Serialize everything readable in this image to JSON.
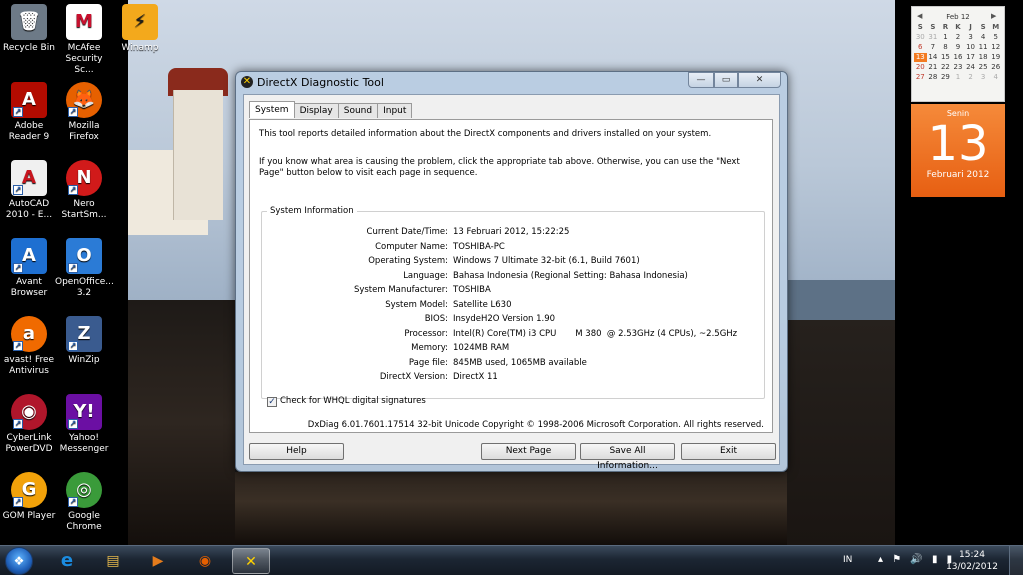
{
  "desktop": {
    "icons": [
      {
        "label": "Recycle Bin",
        "glyph": "🗑",
        "color": "#6d7a87"
      },
      {
        "label": "McAfee Security Sc...",
        "glyph": "M",
        "color": "#c8102e"
      },
      {
        "label": "Winamp",
        "glyph": "⚡",
        "color": "#1f1f1f"
      },
      {
        "label": "Adobe Reader 9",
        "glyph": "A",
        "color": "#b30b00"
      },
      {
        "label": "Mozilla Firefox",
        "glyph": "🦊",
        "color": "#e66000"
      },
      {
        "label": "AutoCAD 2010 - E...",
        "glyph": "A",
        "color": "#c9151e"
      },
      {
        "label": "Nero StartSm...",
        "glyph": "N",
        "color": "#d11a1a"
      },
      {
        "label": "Avant Browser",
        "glyph": "A",
        "color": "#1e6fd1"
      },
      {
        "label": "OpenOffice... 3.2",
        "glyph": "O",
        "color": "#2b7bd6"
      },
      {
        "label": "avast! Free Antivirus",
        "glyph": "a",
        "color": "#f06a00"
      },
      {
        "label": "WinZip",
        "glyph": "Z",
        "color": "#3a5b8f"
      },
      {
        "label": "CyberLink PowerDVD",
        "glyph": "◉",
        "color": "#b0162b"
      },
      {
        "label": "Yahoo! Messenger",
        "glyph": "Y!",
        "color": "#6b0fa3"
      },
      {
        "label": "GOM Player",
        "glyph": "G",
        "color": "#f2a20a"
      },
      {
        "label": "Google Chrome",
        "glyph": "◎",
        "color": "#3a9b3a"
      }
    ]
  },
  "calendar": {
    "month_label": "Feb 12",
    "days_of_week": [
      "S",
      "S",
      "R",
      "K",
      "J",
      "S",
      "M"
    ],
    "weeks": [
      [
        "30",
        "31",
        "1",
        "2",
        "3",
        "4",
        "5"
      ],
      [
        "6",
        "7",
        "8",
        "9",
        "10",
        "11",
        "12"
      ],
      [
        "13",
        "14",
        "15",
        "16",
        "17",
        "18",
        "19"
      ],
      [
        "20",
        "21",
        "22",
        "23",
        "24",
        "25",
        "26"
      ],
      [
        "27",
        "28",
        "29",
        "1",
        "2",
        "3",
        "4"
      ]
    ],
    "day_name": "Senin",
    "day_number": "13",
    "month_year": "Februari 2012",
    "accent_color": "#f37b21"
  },
  "window": {
    "title": "DirectX Diagnostic Tool",
    "controls": {
      "minimize": "—",
      "maximize": "▭",
      "close": "✕"
    },
    "tabs": [
      {
        "label": "System",
        "active": true
      },
      {
        "label": "Display",
        "active": false
      },
      {
        "label": "Sound",
        "active": false
      },
      {
        "label": "Input",
        "active": false
      }
    ],
    "intro_1": "This tool reports detailed information about the DirectX components and drivers installed on your system.",
    "intro_2": "If you know what area is causing the problem, click the appropriate tab above.  Otherwise, you can use the \"Next Page\" button below to visit each page in sequence.",
    "group_label": "System Information",
    "info": [
      {
        "key": "Current Date/Time:",
        "value": "13 Februari 2012, 15:22:25"
      },
      {
        "key": "Computer Name:",
        "value": "TOSHIBA-PC"
      },
      {
        "key": "Operating System:",
        "value": "Windows 7 Ultimate 32-bit (6.1, Build 7601)"
      },
      {
        "key": "Language:",
        "value": "Bahasa Indonesia (Regional Setting: Bahasa Indonesia)"
      },
      {
        "key": "System Manufacturer:",
        "value": "TOSHIBA"
      },
      {
        "key": "System Model:",
        "value": "Satellite L630"
      },
      {
        "key": "BIOS:",
        "value": "InsydeH2O Version 1.90"
      },
      {
        "key": "Processor:",
        "value": "Intel(R) Core(TM) i3 CPU       M 380  @ 2.53GHz (4 CPUs), ~2.5GHz"
      },
      {
        "key": "Memory:",
        "value": "1024MB RAM"
      },
      {
        "key": "Page file:",
        "value": "845MB used, 1065MB available"
      },
      {
        "key": "DirectX Version:",
        "value": "DirectX 11"
      }
    ],
    "checkbox_label": "Check for WHQL digital signatures",
    "checkbox_checked": true,
    "footer": "DxDiag 6.01.7601.17514 32-bit Unicode  Copyright © 1998-2006 Microsoft Corporation.  All rights reserved.",
    "buttons": {
      "help": "Help",
      "next_page": "Next Page",
      "save_all": "Save All Information...",
      "exit": "Exit"
    }
  },
  "taskbar": {
    "start_glyph": "❖",
    "pinned": [
      {
        "name": "internet-explorer-icon",
        "glyph": "e",
        "color": "#1b8ce0"
      },
      {
        "name": "windows-explorer-icon",
        "glyph": "▤",
        "color": "#e3b74b"
      },
      {
        "name": "media-player-icon",
        "glyph": "▶",
        "color": "#e57c1c"
      },
      {
        "name": "firefox-icon",
        "glyph": "◉",
        "color": "#e66000"
      },
      {
        "name": "directx-icon",
        "glyph": "✕",
        "color": "#ffd200"
      }
    ],
    "language": "IN",
    "tray_icons": "▴ ⚑ 🔊 ▮ ▮",
    "time": "15:24",
    "date": "13/02/2012"
  }
}
